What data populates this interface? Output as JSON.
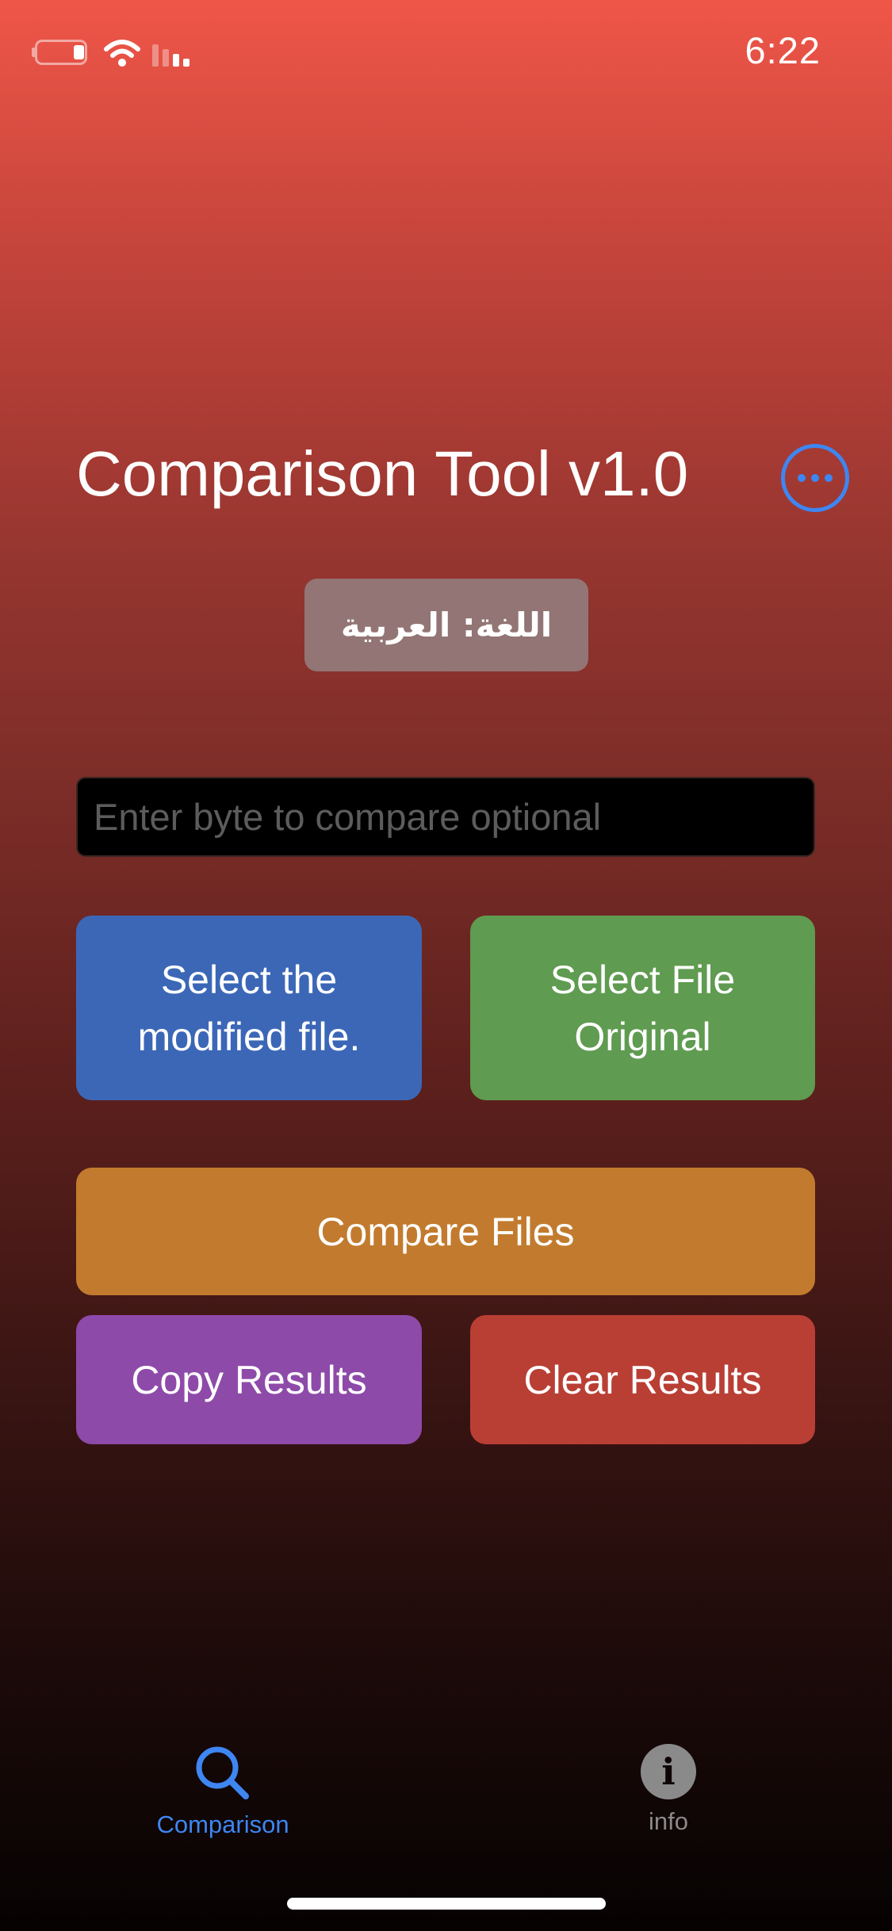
{
  "status_bar": {
    "time": "6:22",
    "icons": [
      "battery-icon",
      "wifi-icon",
      "signal-icon"
    ]
  },
  "header": {
    "title": "Comparison Tool v1.0",
    "more_icon": "ellipsis-circle-icon",
    "accent_color": "#3e86f2"
  },
  "language_button": {
    "label": "اللغة: العربية"
  },
  "byte_input": {
    "value": "",
    "placeholder": "Enter byte to compare optional"
  },
  "buttons": {
    "select_modified": "Select the modified file.",
    "select_original": "Select File Original",
    "compare": "Compare Files",
    "copy": "Copy Results",
    "clear": "Clear Results"
  },
  "button_colors": {
    "select_modified": "#3c67b7",
    "select_original": "#5f9b50",
    "compare": "#c27b2e",
    "copy": "#8e4aa9",
    "clear": "#b93f35"
  },
  "tab_bar": {
    "tabs": [
      {
        "label": "Comparison",
        "icon": "magnifying-glass-icon",
        "selected": true
      },
      {
        "label": "info",
        "icon": "info-circle-icon",
        "selected": false
      }
    ]
  }
}
